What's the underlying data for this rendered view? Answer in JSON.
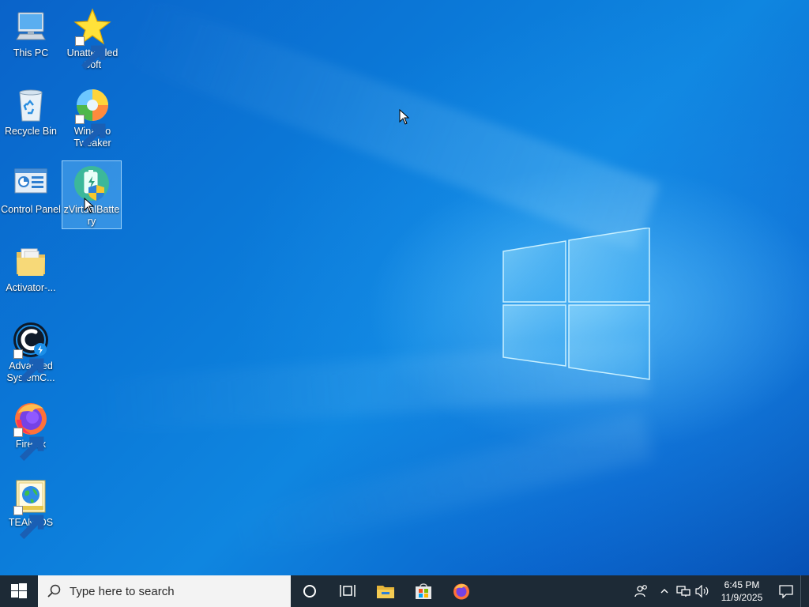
{
  "desktop": {
    "icons": [
      {
        "label": "This PC",
        "icon": "this-pc-icon",
        "shortcut": false
      },
      {
        "label": "Unattended Soft",
        "icon": "star-icon",
        "shortcut": true
      },
      {
        "label": "Recycle Bin",
        "icon": "recycle-bin-icon",
        "shortcut": false
      },
      {
        "label": "Winaero Tweaker",
        "icon": "winaero-tweaker-icon",
        "shortcut": true
      },
      {
        "label": "Control Panel",
        "icon": "control-panel-icon",
        "shortcut": false
      },
      {
        "label": "zVirtualBattery",
        "icon": "battery-shield-icon",
        "shortcut": false,
        "selected": true
      },
      {
        "label": "Activator-...",
        "icon": "folder-icon",
        "shortcut": false
      },
      {
        "label": "Advanced SystemC...",
        "icon": "advanced-systemcare-icon",
        "shortcut": true
      },
      {
        "label": "Firefox",
        "icon": "firefox-icon",
        "shortcut": true
      },
      {
        "label": "TEAM OS",
        "icon": "globe-document-icon",
        "shortcut": true
      }
    ],
    "wallpaper_colors": {
      "base": "#0b79d8",
      "glow": "#7fd2ff"
    }
  },
  "taskbar": {
    "search_placeholder": "Type here to search",
    "pinned": [
      "cortana-icon",
      "task-view-icon",
      "file-explorer-icon",
      "microsoft-store-icon",
      "firefox-icon"
    ],
    "tray_icons": [
      "people-icon",
      "show-hidden-chevron-icon",
      "network-icon",
      "volume-icon"
    ],
    "clock": {
      "time": "6:45 PM",
      "date": "11/9/2025"
    },
    "background": "#1d2a36"
  }
}
